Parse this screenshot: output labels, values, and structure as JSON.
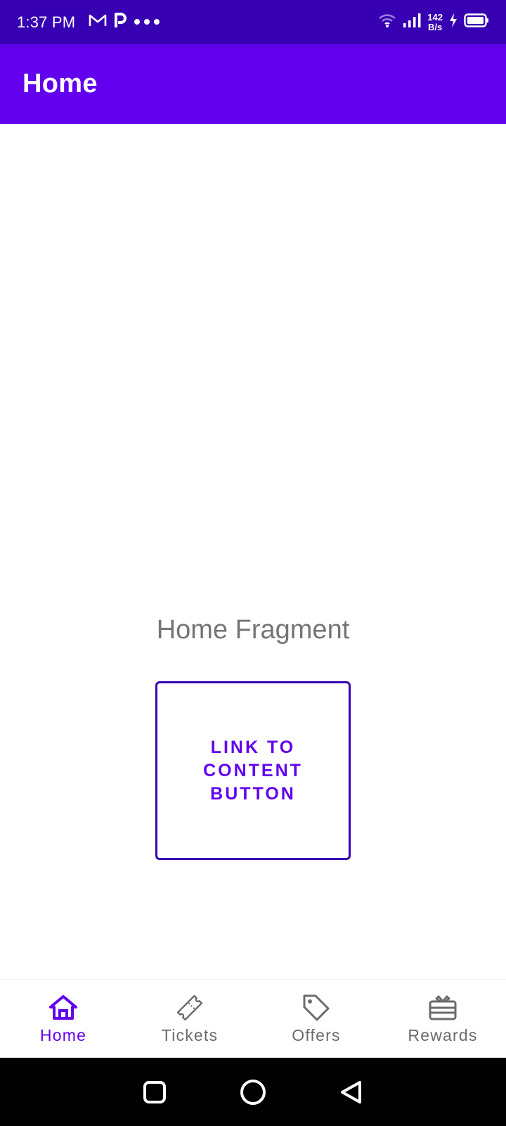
{
  "status_bar": {
    "time": "1:37 PM",
    "net_speed_value": "142",
    "net_speed_unit": "B/s",
    "icons": [
      "gmail-icon",
      "paytm-icon",
      "more-dots-icon",
      "wifi-icon",
      "signal-icon",
      "charging-icon",
      "battery-icon"
    ]
  },
  "app_bar": {
    "title": "Home"
  },
  "content": {
    "fragment_label": "Home Fragment",
    "link_button_label": "LINK TO CONTENT BUTTON"
  },
  "bottom_nav": {
    "items": [
      {
        "label": "Home",
        "icon": "home-icon",
        "active": true
      },
      {
        "label": "Tickets",
        "icon": "ticket-icon",
        "active": false
      },
      {
        "label": "Offers",
        "icon": "tag-icon",
        "active": false
      },
      {
        "label": "Rewards",
        "icon": "gift-card-icon",
        "active": false
      }
    ]
  },
  "colors": {
    "status_bar": "#3700b3",
    "app_bar": "#6200ee",
    "accent": "#6200ee",
    "inactive": "#6b6b6b"
  }
}
